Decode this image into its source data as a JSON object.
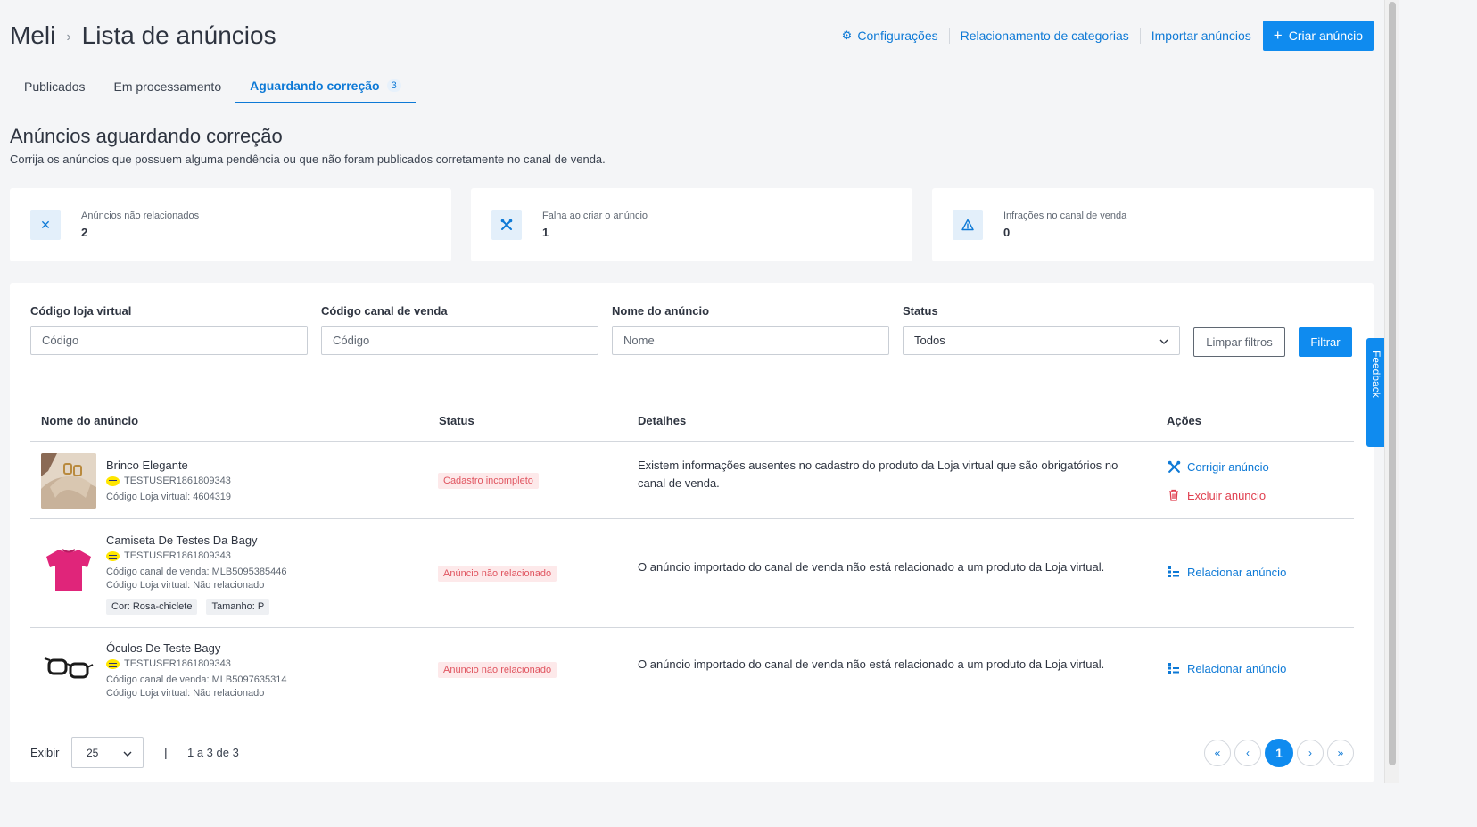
{
  "header": {
    "breadcrumb": [
      "Meli",
      "Lista de anúncios"
    ],
    "links": {
      "config": "Configurações",
      "categories": "Relacionamento de categorias",
      "import": "Importar anúncios"
    },
    "create_button": "Criar anúncio"
  },
  "tabs": [
    {
      "label": "Publicados"
    },
    {
      "label": "Em processamento"
    },
    {
      "label": "Aguardando correção",
      "count": "3",
      "active": true
    }
  ],
  "section": {
    "title": "Anúncios aguardando correção",
    "subtitle": "Corrija os anúncios que possuem alguma pendência ou que não foram publicados corretamente no canal de venda."
  },
  "cards": [
    {
      "label": "Anúncios não relacionados",
      "value": "2",
      "icon": "close-icon"
    },
    {
      "label": "Falha ao criar o anúncio",
      "value": "1",
      "icon": "tools-icon"
    },
    {
      "label": "Infrações no canal de venda",
      "value": "0",
      "icon": "warning-icon"
    }
  ],
  "filters": {
    "store_code": {
      "label": "Código loja virtual",
      "placeholder": "Código"
    },
    "channel_code": {
      "label": "Código canal de venda",
      "placeholder": "Código"
    },
    "name": {
      "label": "Nome do anúncio",
      "placeholder": "Nome"
    },
    "status": {
      "label": "Status",
      "value": "Todos"
    },
    "clear_label": "Limpar filtros",
    "filter_label": "Filtrar"
  },
  "table": {
    "headers": [
      "Nome do anúncio",
      "Status",
      "Detalhes",
      "Ações"
    ],
    "rows": [
      {
        "name": "Brinco Elegante",
        "seller": "TESTUSER1861809343",
        "store_code": "Código Loja virtual: 4604319",
        "status": "Cadastro incompleto",
        "details": "Existem informações ausentes no cadastro do produto da Loja virtual que são obrigatórios no canal de venda.",
        "actions": [
          "Corrigir anúncio",
          "Excluir anúncio"
        ]
      },
      {
        "name": "Camiseta De Testes Da Bagy",
        "seller": "TESTUSER1861809343",
        "channel_code": "Código canal de venda: MLB5095385446",
        "store_code": "Código Loja virtual: Não relacionado",
        "tags": [
          "Cor: Rosa-chiclete",
          "Tamanho: P"
        ],
        "status": "Anúncio não relacionado",
        "details": "O anúncio importado do canal de venda não está relacionado a um produto da Loja virtual.",
        "actions": [
          "Relacionar anúncio"
        ]
      },
      {
        "name": "Óculos De Teste Bagy",
        "seller": "TESTUSER1861809343",
        "channel_code": "Código canal de venda: MLB5097635314",
        "store_code": "Código Loja virtual: Não relacionado",
        "status": "Anúncio não relacionado",
        "details": "O anúncio importado do canal de venda não está relacionado a um produto da Loja virtual.",
        "actions": [
          "Relacionar anúncio"
        ]
      }
    ]
  },
  "footer": {
    "show_label": "Exibir",
    "page_size": "25",
    "separator": "|",
    "range": "1 a 3 de 3",
    "pager": [
      "«",
      "‹",
      "1",
      "›",
      "»"
    ]
  },
  "feedback_label": "Feedback",
  "colors": {
    "primary": "#0f8bef",
    "link": "#0d79d6",
    "danger": "#e04050",
    "badge_bg": "#fde9ea"
  }
}
